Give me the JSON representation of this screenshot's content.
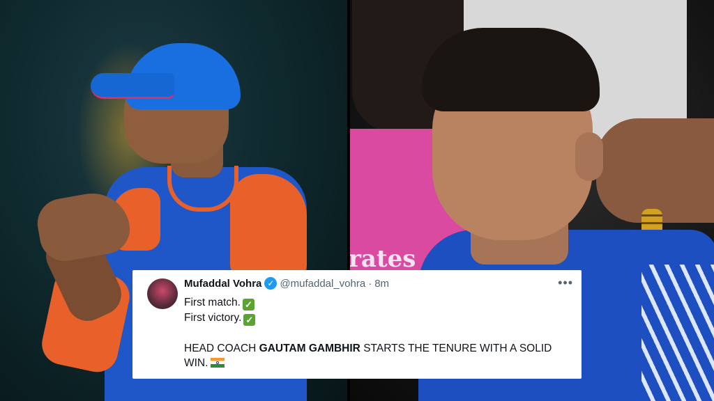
{
  "tweet": {
    "author_name": "Mufaddal Vohra",
    "handle": "@mufaddal_vohra",
    "separator": "·",
    "time": "8m",
    "more_glyph": "•••",
    "line1": "First match.",
    "line2": "First victory.",
    "line3_prefix": "HEAD COACH ",
    "line3_bold": "GAUTAM GAMBHIR",
    "line3_suffix": " STARTS THE TENURE WITH A SOLID",
    "line4": "WIN.",
    "check_glyph": "✓",
    "verified_glyph": "✓"
  },
  "photo_right": {
    "banner_text": "rates"
  },
  "colors": {
    "verified": "#1d9bf0",
    "check": "#5aa532",
    "text": "#0f1419",
    "muted": "#536471"
  },
  "icons": [
    "verified-badge-icon",
    "check-mark-icon",
    "india-flag-icon",
    "more-options-icon"
  ]
}
